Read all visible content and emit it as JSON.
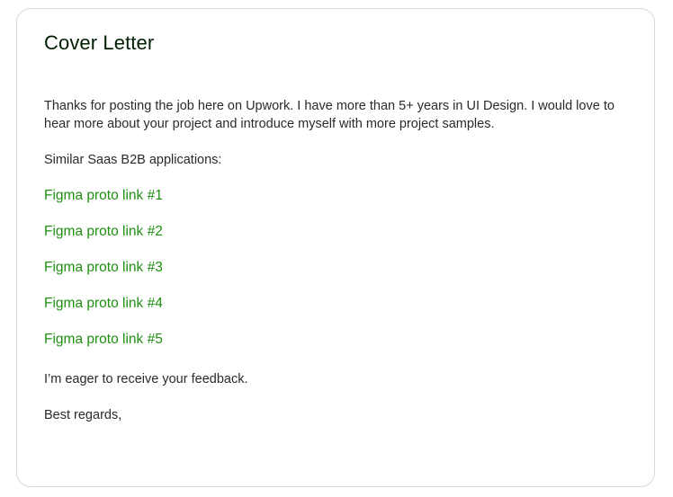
{
  "cover_letter": {
    "title": "Cover Letter",
    "intro": "Thanks for posting the job here on Upwork. I have more than 5+ years in UI Design. I would love to hear more about your project and introduce myself with more project samples.",
    "similar_label": "Similar Saas B2B applications:",
    "links": [
      "Figma proto link #1",
      "Figma proto link #2",
      "Figma proto link #3",
      "Figma proto link #4",
      "Figma proto link #5"
    ],
    "closing": "I’m eager to receive your feedback.",
    "signoff": "Best regards,"
  },
  "colors": {
    "link": "#1f8f12",
    "title": "#001e00",
    "border": "#d9d9d9"
  }
}
